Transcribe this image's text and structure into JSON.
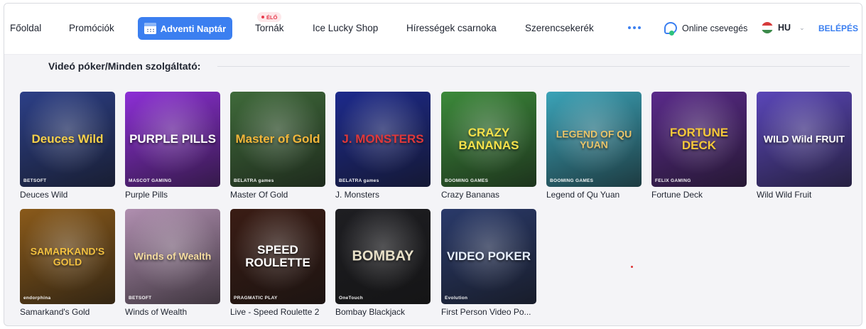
{
  "nav": {
    "items": [
      {
        "label": "Főoldal"
      },
      {
        "label": "Promóciók"
      },
      {
        "label": "Adventi Naptár"
      },
      {
        "label": "Tornák"
      },
      {
        "label": "Ice Lucky Shop"
      },
      {
        "label": "Hírességek csarnoka"
      },
      {
        "label": "Szerencsekerék"
      }
    ],
    "live_badge": "ÉLŐ",
    "chat_label": "Online csevegés",
    "language": "HU",
    "login_label": "BELÉPÉS"
  },
  "section": {
    "title": "Videó póker/Minden szolgáltató:"
  },
  "games": [
    {
      "name": "Deuces Wild",
      "art_text": "Deuces Wild",
      "provider": "BETSOFT",
      "bg": "#2c3f87"
    },
    {
      "name": "Purple Pills",
      "art_text": "PURPLE PILLS",
      "provider": "MASCOT GAMING",
      "bg": "#8d2fd6"
    },
    {
      "name": "Master Of Gold",
      "art_text": "Master of Gold",
      "provider": "BELATRA games",
      "bg": "#3f6a3a"
    },
    {
      "name": "J. Monsters",
      "art_text": "J. MONSTERS",
      "provider": "BELATRA games",
      "bg": "#1d2a8c"
    },
    {
      "name": "Crazy Bananas",
      "art_text": "CRAZY BANANAS",
      "provider": "BOOMING GAMES",
      "bg": "#3c8a3a"
    },
    {
      "name": "Legend of Qu Yuan",
      "art_text": "LEGEND OF QU YUAN",
      "provider": "BOOMING GAMES",
      "bg": "#3ba3b8"
    },
    {
      "name": "Fortune Deck",
      "art_text": "FORTUNE DECK",
      "provider": "FELIX GAMING",
      "bg": "#5a2a8a"
    },
    {
      "name": "Wild Wild Fruit",
      "art_text": "WILD Wild FRUIT",
      "provider": "",
      "bg": "#5a46b8"
    },
    {
      "name": "Samarkand's Gold",
      "art_text": "SAMARKAND'S GOLD",
      "provider": "endorphina",
      "bg": "#8a5a1a"
    },
    {
      "name": "Winds of Wealth",
      "art_text": "Winds of Wealth",
      "provider": "BETSOFT",
      "bg": "#b08fb0"
    },
    {
      "name": "Live - Speed Roulette 2",
      "art_text": "SPEED ROULETTE",
      "provider": "PRAGMATIC PLAY",
      "bg": "#3a1c14"
    },
    {
      "name": "Bombay Blackjack",
      "art_text": "BOMBAY",
      "provider": "OneTouch",
      "bg": "#1e1e22"
    },
    {
      "name": "First Person Video Po...",
      "art_text": "VIDEO POKER",
      "provider": "Evolution",
      "bg": "#2a3a6a"
    }
  ],
  "colors": {
    "accent": "#3b7ff0",
    "live": "#e8394c"
  }
}
